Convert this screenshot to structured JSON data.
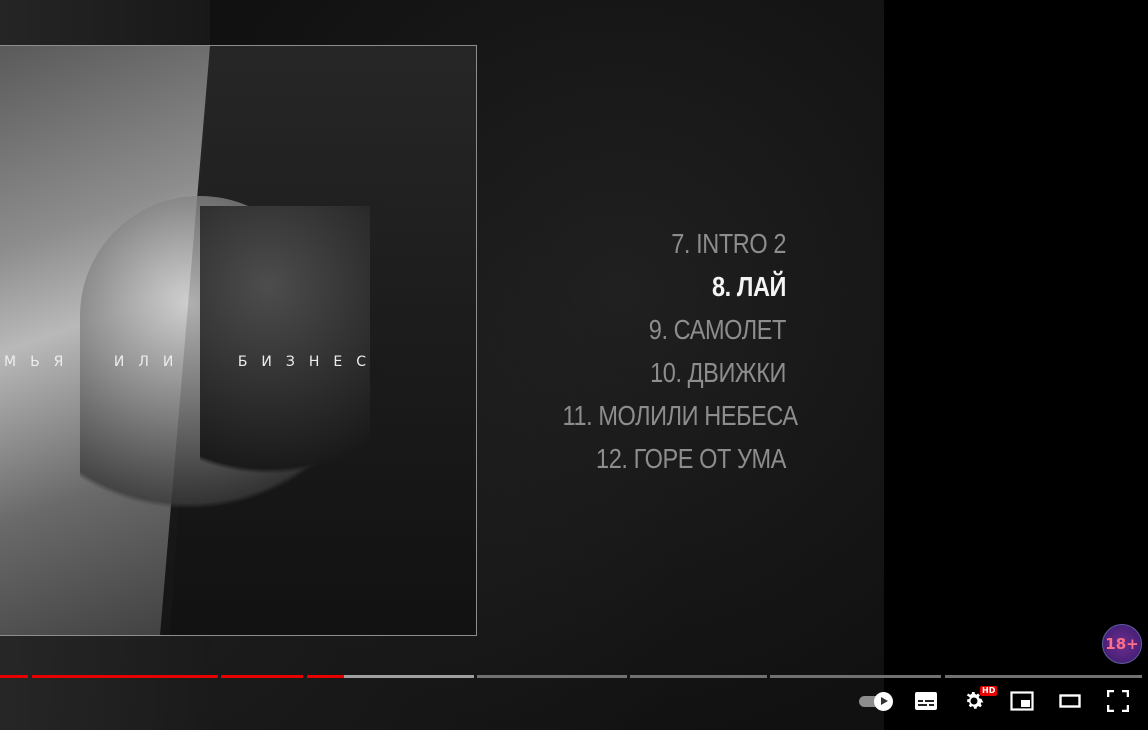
{
  "album": {
    "title_parts": [
      "МЬЯ",
      "ИЛИ",
      "БИЗНЕС"
    ]
  },
  "tracklist": [
    {
      "label": "7. INTRO 2",
      "active": false
    },
    {
      "label": "8. ЛАЙ",
      "active": true
    },
    {
      "label": "9. САМОЛЕТ",
      "active": false
    },
    {
      "label": "10. ДВИЖКИ",
      "active": false
    },
    {
      "label": "11. МОЛИЛИ НЕБЕСА",
      "active": false
    },
    {
      "label": "12. ГОРЕ ОТ УМА",
      "active": false
    }
  ],
  "rating_badge": "18+",
  "player": {
    "progress_fraction": 0.3,
    "buffered_fraction": 0.41,
    "settings_badge": "HD",
    "colors": {
      "played": "#e60000",
      "unplayed": "#717171",
      "buffered": "#a0a0a0"
    },
    "icons": [
      "autoplay-toggle-icon",
      "subtitles-icon",
      "settings-gear-icon",
      "miniplayer-icon",
      "theater-mode-icon",
      "fullscreen-icon"
    ]
  }
}
